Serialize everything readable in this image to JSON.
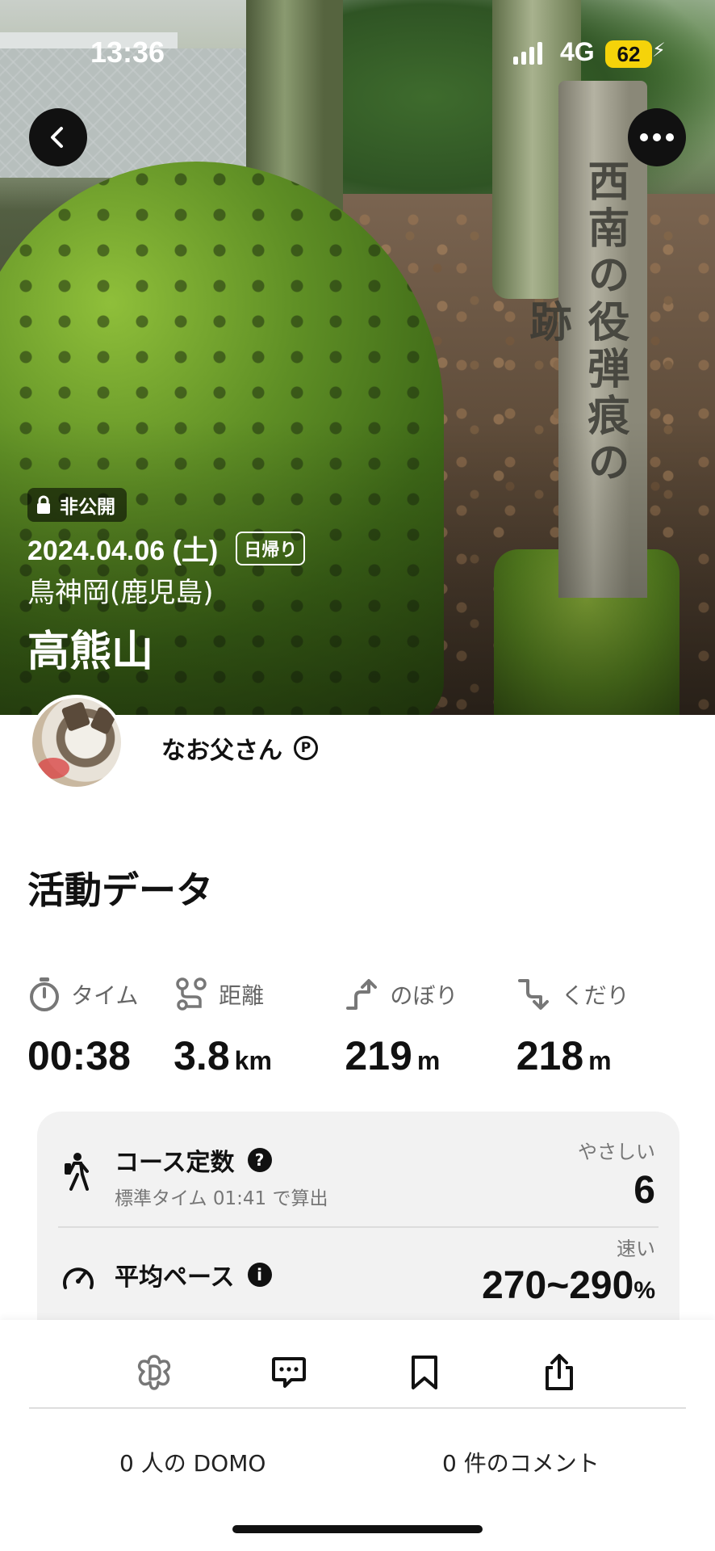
{
  "status_bar": {
    "time": "13:36",
    "network": "4G",
    "battery": "62"
  },
  "photo": {
    "post_inscription": "西南の役弾痕の跡"
  },
  "hero": {
    "privacy": "非公開",
    "date": "2024.04.06 (土)",
    "trip_type": "日帰り",
    "area": "鳥神岡(鹿児島)",
    "mountain": "高熊山"
  },
  "user": {
    "name": "なお父さん",
    "badge": "P"
  },
  "activity": {
    "title": "活動データ",
    "stats": [
      {
        "label": "タイム",
        "value": "00:38",
        "unit": "",
        "icon": "stopwatch-icon"
      },
      {
        "label": "距離",
        "value": "3.8",
        "unit": "km",
        "icon": "route-icon"
      },
      {
        "label": "のぼり",
        "value": "219",
        "unit": "m",
        "icon": "ascent-icon"
      },
      {
        "label": "くだり",
        "value": "218",
        "unit": "m",
        "icon": "descent-icon"
      }
    ],
    "course": {
      "label": "コース定数",
      "sub": "標準タイム 01:41 で算出",
      "difficulty": "やさしい",
      "value": "6"
    },
    "pace": {
      "label": "平均ペース",
      "speed": "速い",
      "value": "270~290",
      "unit": "%"
    }
  },
  "footer": {
    "domo_count": "0 人の DOMO",
    "comment_count": "0 件のコメント"
  },
  "colors": {
    "battery": "#f5d30a",
    "card_bg": "#f2f2f2"
  }
}
